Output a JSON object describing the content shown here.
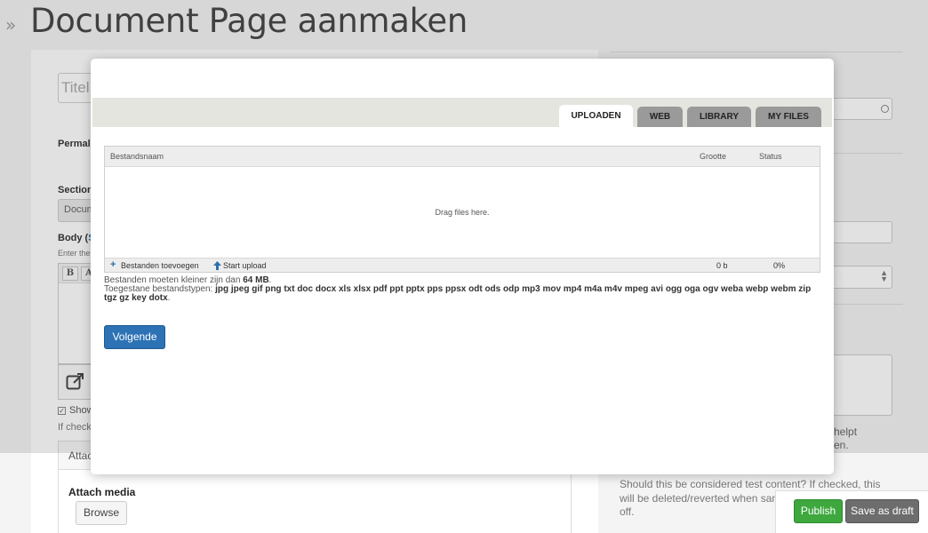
{
  "page": {
    "title": "Document Page aanmaken",
    "title_placeholder": "Titel",
    "permalink_label": "Permal",
    "section_label": "Section",
    "section_value": "Docum",
    "body_label": "Body (",
    "body_link": "S",
    "body_hint": "Enter the",
    "editor_bold": "B",
    "editor_italic": "A",
    "show_checkbox_label": "Show",
    "if_checked_text": "If check",
    "attach_panel_title": "Attac",
    "attach_media_label": "Attach media",
    "browse_label": "Browse",
    "right_help_1": "helpt",
    "right_help_2": "en.",
    "test_content_text": "Should this be considered test content? If checked, this will be deleted/reverted when sandbox mode is turned off.",
    "publish_label": "Publish",
    "save_draft_label": "Save as draft"
  },
  "modal": {
    "tabs": [
      {
        "label": "UPLOADEN",
        "active": true
      },
      {
        "label": "WEB",
        "active": false
      },
      {
        "label": "LIBRARY",
        "active": false
      },
      {
        "label": "MY FILES",
        "active": false
      }
    ],
    "table": {
      "col_filename": "Bestandsnaam",
      "col_size": "Grootte",
      "col_status": "Status",
      "drop_text": "Drag files here.",
      "add_files": "Bestanden toevoegen",
      "start_upload": "Start upload",
      "total_size": "0 b",
      "total_percent": "0%"
    },
    "limits": {
      "max_size_prefix": "Bestanden moeten kleiner zijn dan",
      "max_size_value": "64 MB",
      "max_size_suffix": ".",
      "allowed_prefix": "Toegestane bestandstypen:",
      "allowed_types": "jpg jpeg gif png txt doc docx xls xlsx pdf ppt pptx pps ppsx odt ods odp mp3 mov mp4 m4a m4v mpeg avi ogg oga ogv weba webp webm zip tgz gz key dotx",
      "allowed_suffix": "."
    },
    "next_label": "Volgende"
  },
  "colors": {
    "primary": "#2d72b5",
    "publish": "#3ea83f",
    "draft": "#6d6d6d"
  }
}
